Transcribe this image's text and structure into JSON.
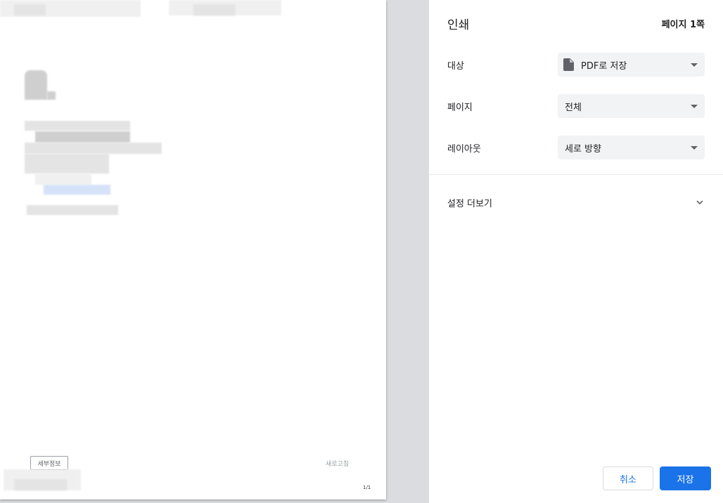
{
  "preview": {
    "details_button": "세부정보",
    "refresh_label": "새로고침",
    "page_indicator": "1/1"
  },
  "sidebar": {
    "title": "인쇄",
    "page_count": "페이지 1쪽",
    "settings": [
      {
        "label": "대상",
        "value": "PDF로 저장",
        "icon": "document-icon"
      },
      {
        "label": "페이지",
        "value": "전체"
      },
      {
        "label": "레이아웃",
        "value": "세로 방향"
      }
    ],
    "more_settings": "설정 더보기",
    "cancel_label": "취소",
    "save_label": "저장"
  },
  "colors": {
    "accent": "#1a73e8",
    "select_bg": "#f1f3f4",
    "preview_bg": "#dadce0"
  }
}
